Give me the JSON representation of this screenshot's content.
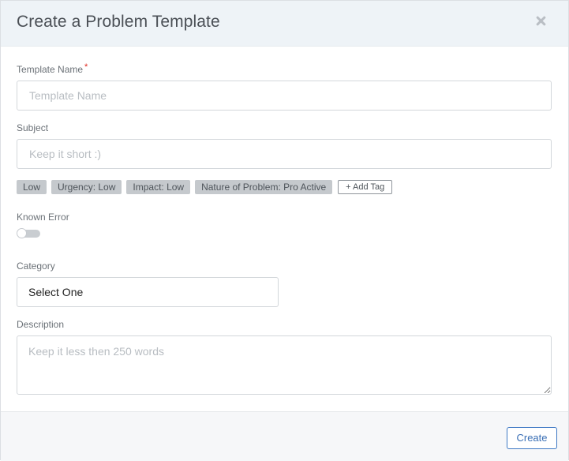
{
  "modal": {
    "title": "Create a Problem Template",
    "close_icon": "close-icon"
  },
  "fields": {
    "template_name": {
      "label": "Template Name",
      "required_mark": "*",
      "placeholder": "Template Name",
      "value": ""
    },
    "subject": {
      "label": "Subject",
      "placeholder": "Keep it short :)",
      "value": ""
    },
    "tags": [
      "Low",
      "Urgency: Low",
      "Impact: Low",
      "Nature of Problem: Pro Active"
    ],
    "add_tag_label": "+ Add Tag",
    "known_error": {
      "label": "Known Error",
      "enabled": false
    },
    "category": {
      "label": "Category",
      "selected": "Select One"
    },
    "description": {
      "label": "Description",
      "placeholder": "Keep it less then 250 words",
      "value": ""
    }
  },
  "footer": {
    "create_label": "Create"
  },
  "colors": {
    "header_bg": "#eef3f7",
    "footer_bg": "#f6f7f9",
    "tag_bg": "#c5c9cd",
    "accent": "#3f79c4",
    "required": "#e0281f"
  }
}
